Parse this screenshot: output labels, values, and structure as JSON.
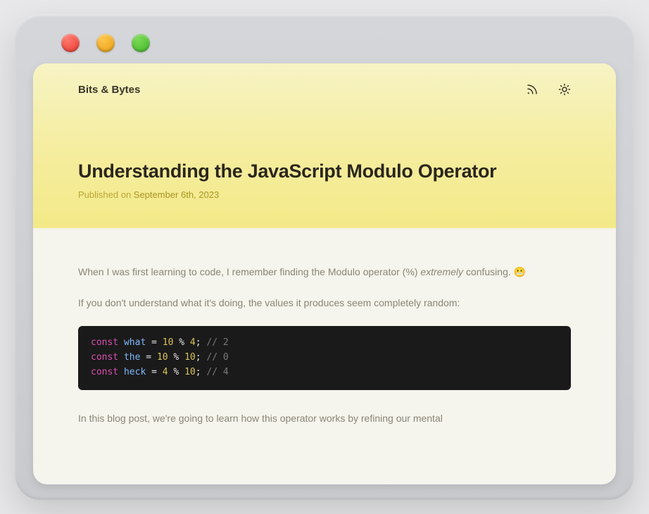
{
  "site": {
    "title": "Bits & Bytes"
  },
  "article": {
    "title": "Understanding the JavaScript Modulo Operator",
    "published_prefix": "Published on ",
    "published_date": "September 6th, 2023"
  },
  "paragraphs": {
    "p1_a": "When I was first learning to code, I remember finding the Modulo operator (%) ",
    "p1_em": "extremely",
    "p1_b": " confusing. 😬",
    "p2": "If you don't understand what it's doing, the values it produces seem completely random:",
    "p3": "In this blog post, we're going to learn how this operator works by refining our mental"
  },
  "code": {
    "lines": [
      {
        "kw": "const",
        "var": "what",
        "eq": " = ",
        "lhs": "10",
        "op": " % ",
        "rhs": "4",
        "end": ";",
        "cmt": " // 2"
      },
      {
        "kw": "const",
        "var": "the",
        "eq": " = ",
        "lhs": "10",
        "op": " % ",
        "rhs": "10",
        "end": ";",
        "cmt": " // 0"
      },
      {
        "kw": "const",
        "var": "heck",
        "eq": " = ",
        "lhs": "4",
        "op": " % ",
        "rhs": "10",
        "end": ";",
        "cmt": " // 4"
      }
    ]
  }
}
